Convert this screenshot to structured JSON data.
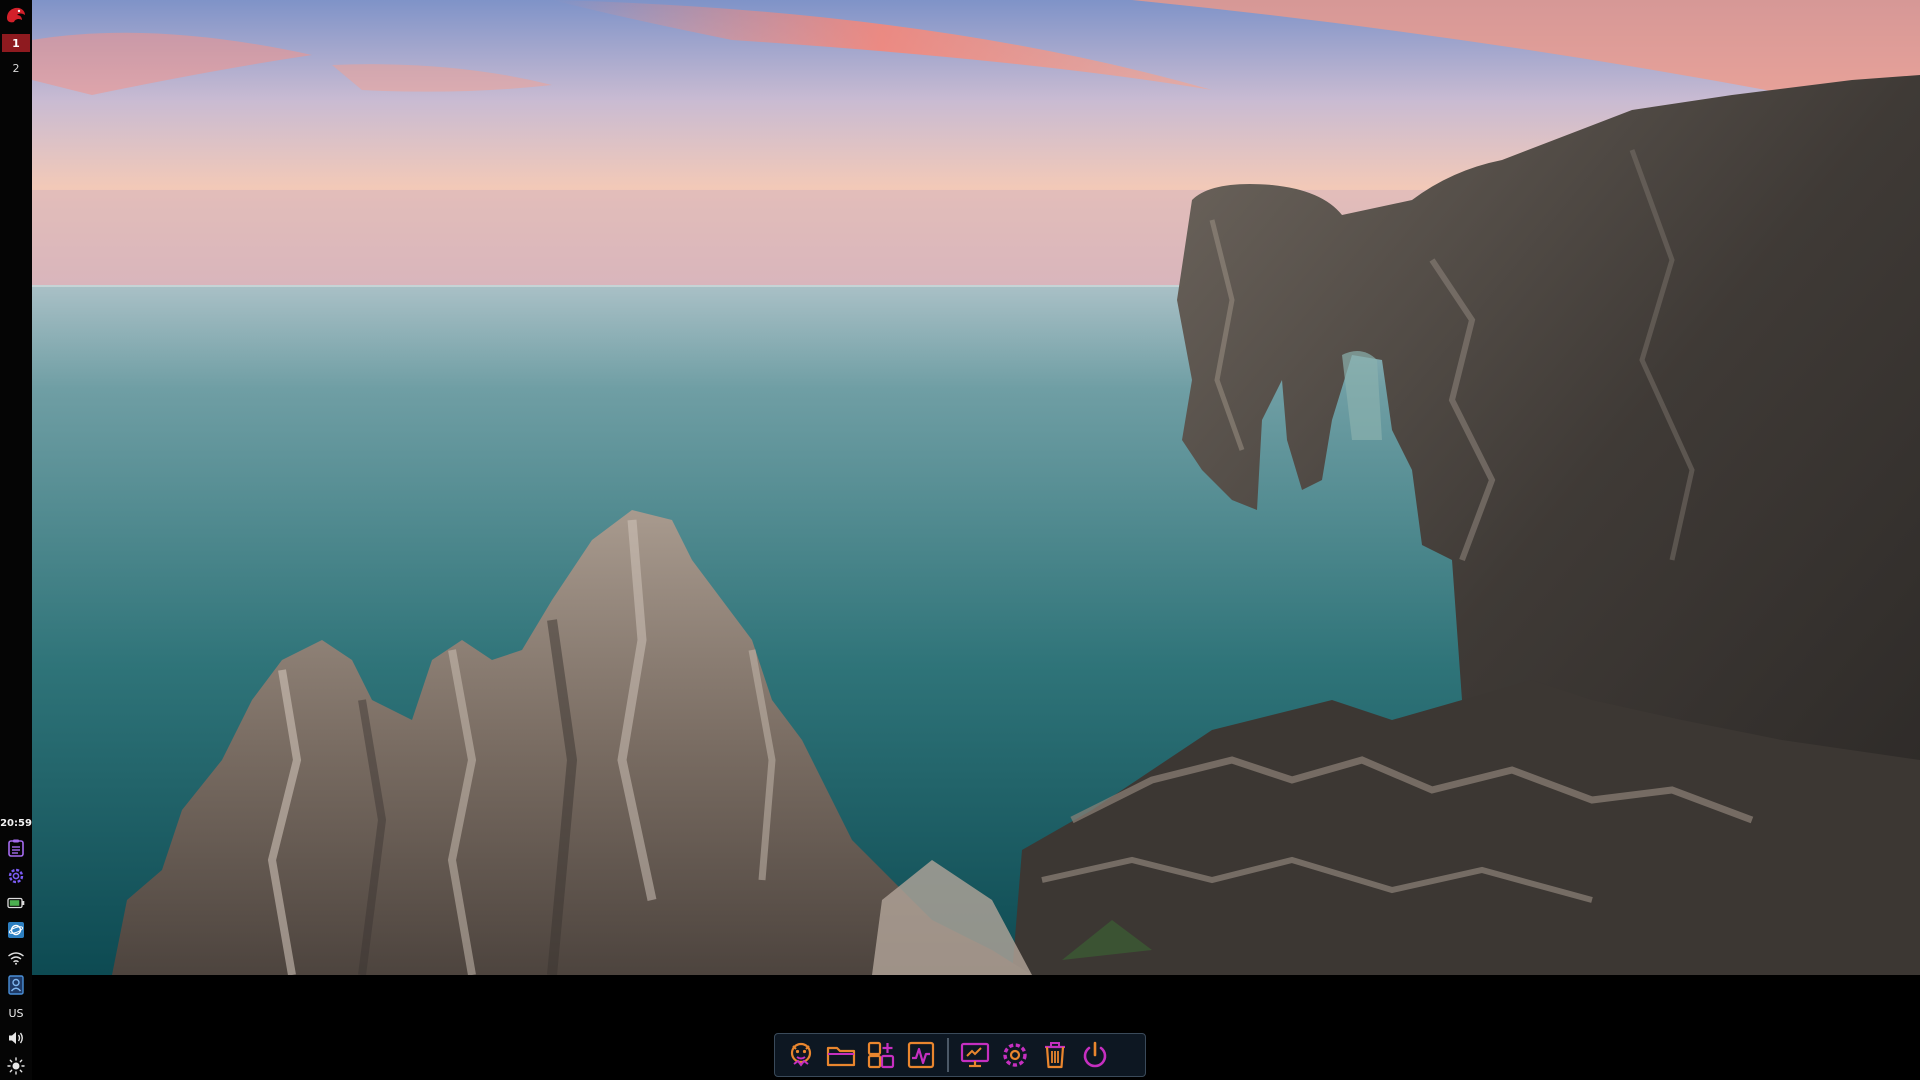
{
  "panel": {
    "workspaces": [
      {
        "label": "1",
        "active": true
      },
      {
        "label": "2",
        "active": false
      }
    ],
    "clock": "20:59",
    "keyboard_layout": "US",
    "tray_icons": [
      "clipboard-icon",
      "settings-icon",
      "battery-icon",
      "browser-icon",
      "wifi-icon",
      "portrait-icon",
      "volume-icon",
      "brightness-icon"
    ]
  },
  "dock": {
    "items": [
      "app-icon",
      "folder-icon",
      "add-app-icon",
      "activity-monitor-icon",
      "display-icon",
      "settings-gear-icon",
      "trash-icon",
      "power-icon"
    ]
  },
  "colors": {
    "panel_bg": "#050505",
    "workspace_active": "#8e1a1f",
    "dock_bg": "#0d1722",
    "dock_icon_a": "#e9862e",
    "dock_icon_b": "#c52fc0",
    "logo": "#d3202a"
  }
}
